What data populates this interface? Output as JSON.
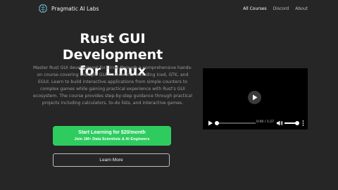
{
  "header": {
    "brand": "Pragmatic AI Labs",
    "nav": [
      {
        "label": "All Courses",
        "active": true
      },
      {
        "label": "Discord",
        "active": false
      },
      {
        "label": "About",
        "active": false
      }
    ]
  },
  "hero": {
    "title_line1": "Rust GUI Development",
    "title_line2": "for Linux",
    "description": "Master Rust GUI development for Linux through a comprehensive hands-on course covering multiple GUI frameworks including Iced, GTK, and EGUI. Learn to build interactive applications from simple counters to complex games while gaining practical experience with Rust's GUI ecosystem. The course provides step-by-step guidance through practical projects including calculators, to-do lists, and interactive games.",
    "cta_primary_line1": "Start Learning for $20/month",
    "cta_primary_line2": "Join 1M+ Data Scientists & AI Engineers",
    "cta_secondary": "Learn More"
  },
  "video": {
    "time": "0:00 / 1:27",
    "progress": 0,
    "volume": 1
  },
  "colors": {
    "background": "#262626",
    "accent": "#2ecc5f",
    "text_muted": "#9a9a9a"
  },
  "icons": [
    "brain-logo-icon",
    "play-icon",
    "volume-icon",
    "more-options-icon"
  ]
}
